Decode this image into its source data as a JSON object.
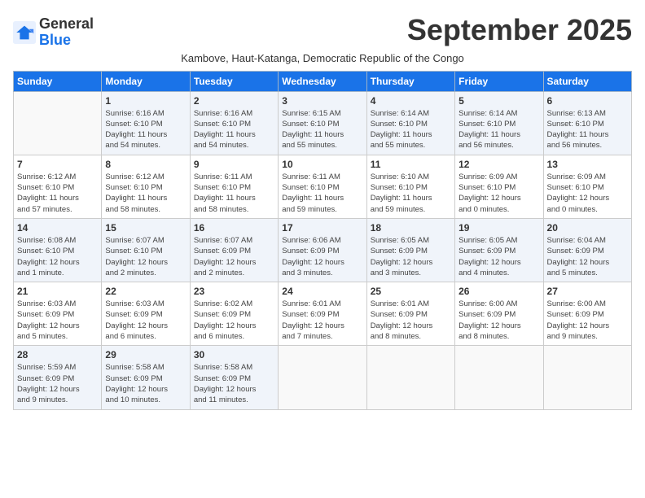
{
  "logo": {
    "general": "General",
    "blue": "Blue"
  },
  "title": "September 2025",
  "subtitle": "Kambove, Haut-Katanga, Democratic Republic of the Congo",
  "days_of_week": [
    "Sunday",
    "Monday",
    "Tuesday",
    "Wednesday",
    "Thursday",
    "Friday",
    "Saturday"
  ],
  "weeks": [
    [
      {
        "day": "",
        "info": ""
      },
      {
        "day": "1",
        "info": "Sunrise: 6:16 AM\nSunset: 6:10 PM\nDaylight: 11 hours\nand 54 minutes."
      },
      {
        "day": "2",
        "info": "Sunrise: 6:16 AM\nSunset: 6:10 PM\nDaylight: 11 hours\nand 54 minutes."
      },
      {
        "day": "3",
        "info": "Sunrise: 6:15 AM\nSunset: 6:10 PM\nDaylight: 11 hours\nand 55 minutes."
      },
      {
        "day": "4",
        "info": "Sunrise: 6:14 AM\nSunset: 6:10 PM\nDaylight: 11 hours\nand 55 minutes."
      },
      {
        "day": "5",
        "info": "Sunrise: 6:14 AM\nSunset: 6:10 PM\nDaylight: 11 hours\nand 56 minutes."
      },
      {
        "day": "6",
        "info": "Sunrise: 6:13 AM\nSunset: 6:10 PM\nDaylight: 11 hours\nand 56 minutes."
      }
    ],
    [
      {
        "day": "7",
        "info": "Sunrise: 6:12 AM\nSunset: 6:10 PM\nDaylight: 11 hours\nand 57 minutes."
      },
      {
        "day": "8",
        "info": "Sunrise: 6:12 AM\nSunset: 6:10 PM\nDaylight: 11 hours\nand 58 minutes."
      },
      {
        "day": "9",
        "info": "Sunrise: 6:11 AM\nSunset: 6:10 PM\nDaylight: 11 hours\nand 58 minutes."
      },
      {
        "day": "10",
        "info": "Sunrise: 6:11 AM\nSunset: 6:10 PM\nDaylight: 11 hours\nand 59 minutes."
      },
      {
        "day": "11",
        "info": "Sunrise: 6:10 AM\nSunset: 6:10 PM\nDaylight: 11 hours\nand 59 minutes."
      },
      {
        "day": "12",
        "info": "Sunrise: 6:09 AM\nSunset: 6:10 PM\nDaylight: 12 hours\nand 0 minutes."
      },
      {
        "day": "13",
        "info": "Sunrise: 6:09 AM\nSunset: 6:10 PM\nDaylight: 12 hours\nand 0 minutes."
      }
    ],
    [
      {
        "day": "14",
        "info": "Sunrise: 6:08 AM\nSunset: 6:10 PM\nDaylight: 12 hours\nand 1 minute."
      },
      {
        "day": "15",
        "info": "Sunrise: 6:07 AM\nSunset: 6:10 PM\nDaylight: 12 hours\nand 2 minutes."
      },
      {
        "day": "16",
        "info": "Sunrise: 6:07 AM\nSunset: 6:09 PM\nDaylight: 12 hours\nand 2 minutes."
      },
      {
        "day": "17",
        "info": "Sunrise: 6:06 AM\nSunset: 6:09 PM\nDaylight: 12 hours\nand 3 minutes."
      },
      {
        "day": "18",
        "info": "Sunrise: 6:05 AM\nSunset: 6:09 PM\nDaylight: 12 hours\nand 3 minutes."
      },
      {
        "day": "19",
        "info": "Sunrise: 6:05 AM\nSunset: 6:09 PM\nDaylight: 12 hours\nand 4 minutes."
      },
      {
        "day": "20",
        "info": "Sunrise: 6:04 AM\nSunset: 6:09 PM\nDaylight: 12 hours\nand 5 minutes."
      }
    ],
    [
      {
        "day": "21",
        "info": "Sunrise: 6:03 AM\nSunset: 6:09 PM\nDaylight: 12 hours\nand 5 minutes."
      },
      {
        "day": "22",
        "info": "Sunrise: 6:03 AM\nSunset: 6:09 PM\nDaylight: 12 hours\nand 6 minutes."
      },
      {
        "day": "23",
        "info": "Sunrise: 6:02 AM\nSunset: 6:09 PM\nDaylight: 12 hours\nand 6 minutes."
      },
      {
        "day": "24",
        "info": "Sunrise: 6:01 AM\nSunset: 6:09 PM\nDaylight: 12 hours\nand 7 minutes."
      },
      {
        "day": "25",
        "info": "Sunrise: 6:01 AM\nSunset: 6:09 PM\nDaylight: 12 hours\nand 8 minutes."
      },
      {
        "day": "26",
        "info": "Sunrise: 6:00 AM\nSunset: 6:09 PM\nDaylight: 12 hours\nand 8 minutes."
      },
      {
        "day": "27",
        "info": "Sunrise: 6:00 AM\nSunset: 6:09 PM\nDaylight: 12 hours\nand 9 minutes."
      }
    ],
    [
      {
        "day": "28",
        "info": "Sunrise: 5:59 AM\nSunset: 6:09 PM\nDaylight: 12 hours\nand 9 minutes."
      },
      {
        "day": "29",
        "info": "Sunrise: 5:58 AM\nSunset: 6:09 PM\nDaylight: 12 hours\nand 10 minutes."
      },
      {
        "day": "30",
        "info": "Sunrise: 5:58 AM\nSunset: 6:09 PM\nDaylight: 12 hours\nand 11 minutes."
      },
      {
        "day": "",
        "info": ""
      },
      {
        "day": "",
        "info": ""
      },
      {
        "day": "",
        "info": ""
      },
      {
        "day": "",
        "info": ""
      }
    ]
  ]
}
